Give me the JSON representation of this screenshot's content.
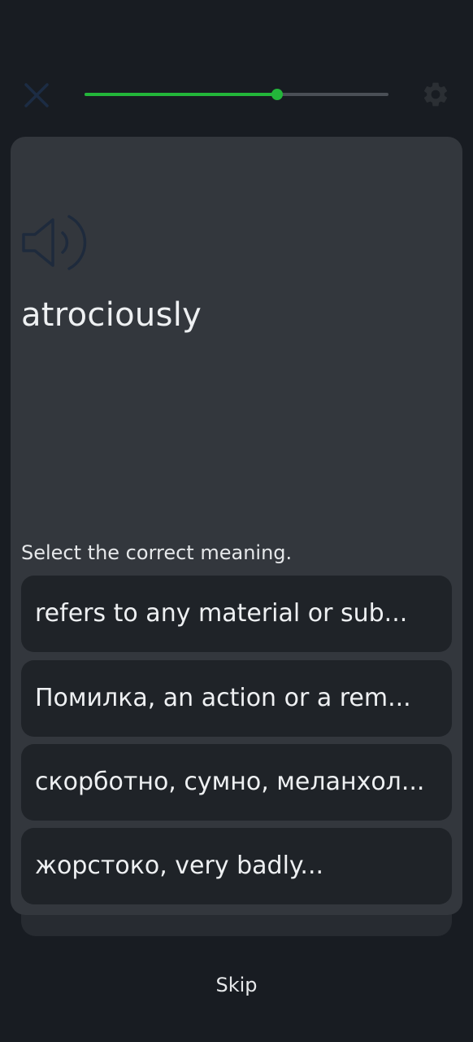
{
  "header": {
    "close_icon": "close-icon",
    "settings_icon": "gear-icon",
    "progress": 0.635,
    "progress_color": "#23b63a"
  },
  "card": {
    "speaker_icon": "speaker-icon",
    "word": "atrociously",
    "prompt": "Select the correct meaning.",
    "options": [
      {
        "label": "refers to any material or sub..."
      },
      {
        "label": "Помилка,  an action or a rem..."
      },
      {
        "label": "скорботно, сумно, меланхол..."
      },
      {
        "label": "жорстоко,  very badly..."
      }
    ]
  },
  "footer": {
    "skip_label": "Skip"
  }
}
